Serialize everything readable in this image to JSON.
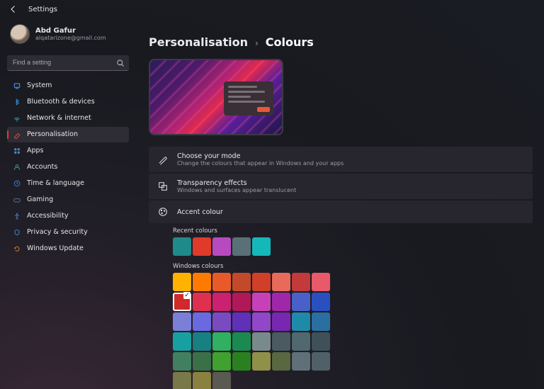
{
  "header": {
    "title": "Settings"
  },
  "user": {
    "name": "Abd Gafur",
    "email": "alqatarizone@gmail.com"
  },
  "search": {
    "placeholder": "Find a setting"
  },
  "sidebar": {
    "items": [
      {
        "label": "System",
        "icon": "system",
        "color": "#4aa0ff"
      },
      {
        "label": "Bluetooth & devices",
        "icon": "bluetooth",
        "color": "#3a8de0"
      },
      {
        "label": "Network & internet",
        "icon": "network",
        "color": "#35b7c8"
      },
      {
        "label": "Personalisation",
        "icon": "personalisation",
        "color": "#d64a3b",
        "selected": true
      },
      {
        "label": "Apps",
        "icon": "apps",
        "color": "#4a8fbf"
      },
      {
        "label": "Accounts",
        "icon": "accounts",
        "color": "#3aa068"
      },
      {
        "label": "Time & language",
        "icon": "time",
        "color": "#3a7fd0"
      },
      {
        "label": "Gaming",
        "icon": "gaming",
        "color": "#5a6f8a"
      },
      {
        "label": "Accessibility",
        "icon": "accessibility",
        "color": "#5a7fbf"
      },
      {
        "label": "Privacy & security",
        "icon": "privacy",
        "color": "#3a8fc0"
      },
      {
        "label": "Windows Update",
        "icon": "update",
        "color": "#d07830"
      }
    ]
  },
  "breadcrumb": {
    "parent": "Personalisation",
    "current": "Colours"
  },
  "cards": {
    "mode": {
      "title": "Choose your mode",
      "sub": "Change the colours that appear in Windows and your apps"
    },
    "transparency": {
      "title": "Transparency effects",
      "sub": "Windows and surfaces appear translucent"
    },
    "accent": {
      "title": "Accent colour"
    }
  },
  "sections": {
    "recent_title": "Recent colours",
    "recent": [
      "#1f8a8a",
      "#e03a2a",
      "#b74ac0",
      "#5a7078",
      "#14b8b8"
    ],
    "windows_title": "Windows colours",
    "windows_selected_index": 8,
    "windows": [
      "#ffb300",
      "#ff7a00",
      "#e85a2a",
      "#c24a2a",
      "#d04028",
      "#e86a5a",
      "#c23a3a",
      "#e85a6a",
      "#d02a2a",
      "#e03050",
      "#cc2070",
      "#b01858",
      "#c840b8",
      "#a028a8",
      "#4a60c8",
      "#2a50c0",
      "#7a80d8",
      "#6a6ae0",
      "#7a4ac0",
      "#6030b8",
      "#9048c8",
      "#7828b0",
      "#1f8aa8",
      "#2a6fa0",
      "#18a0a0",
      "#188080",
      "#30b060",
      "#1a8a50",
      "#788a8a",
      "#4a5a60",
      "#506870",
      "#405058",
      "#408060",
      "#3a7048",
      "#40a030",
      "#2a8020",
      "#909048",
      "#586840",
      "#607078",
      "#506068",
      "#787848",
      "#8a8040",
      "#5a5a50"
    ]
  }
}
